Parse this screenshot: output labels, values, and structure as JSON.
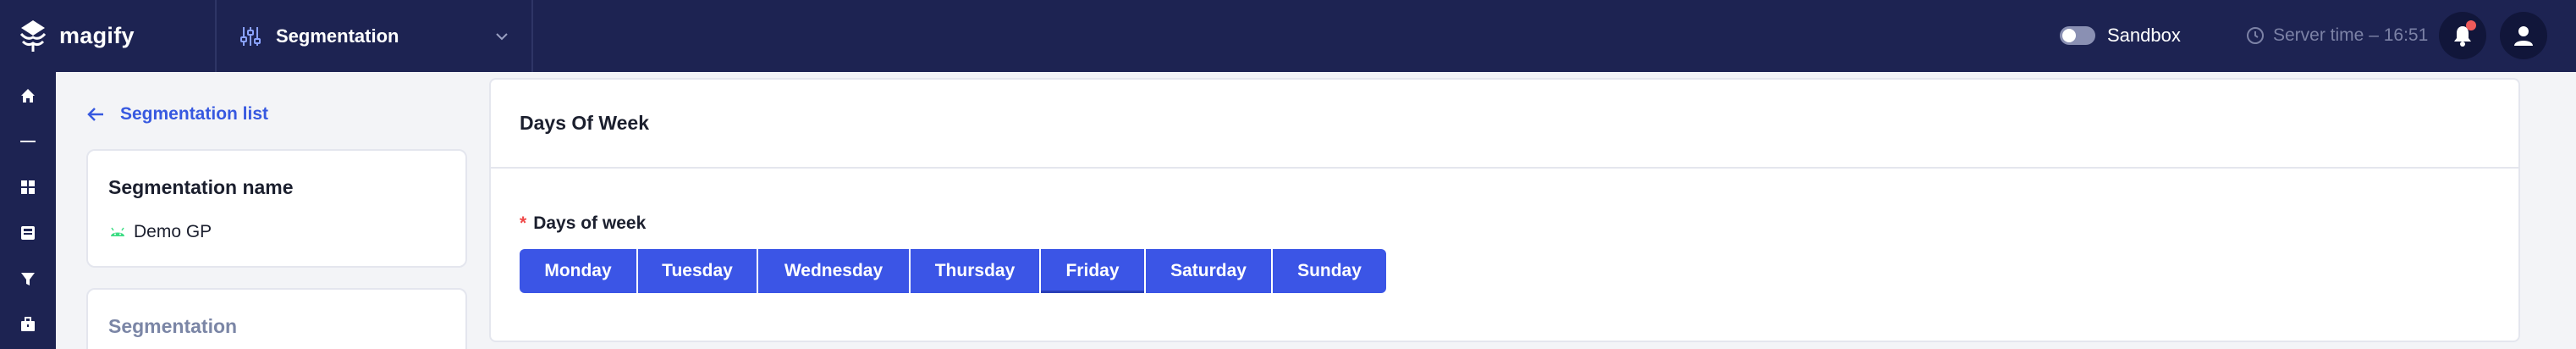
{
  "header": {
    "logo_text": "magify",
    "app_select_label": "Segmentation",
    "sandbox_label": "Sandbox",
    "sandbox_on": false,
    "server_time": "Server time – 16:51"
  },
  "rail": {
    "items": [
      "home-icon",
      "dash-icon",
      "grid-icon",
      "inbox-icon",
      "filter-icon",
      "briefcase-icon"
    ]
  },
  "left": {
    "back_label": "Segmentation list",
    "name_card_title": "Segmentation name",
    "segment_name": "Demo GP",
    "segmentation_card_title": "Segmentation"
  },
  "main": {
    "title": "Days Of Week",
    "field_label": "Days of week",
    "days": [
      "Monday",
      "Tuesday",
      "Wednesday",
      "Thursday",
      "Friday",
      "Saturday",
      "Sunday"
    ]
  },
  "colors": {
    "nav_bg": "#1d2352",
    "accent": "#3b55e6",
    "link": "#3759e0",
    "required": "#ef4747",
    "notification_dot": "#ef5a5a",
    "android_green": "#3ddc84"
  }
}
